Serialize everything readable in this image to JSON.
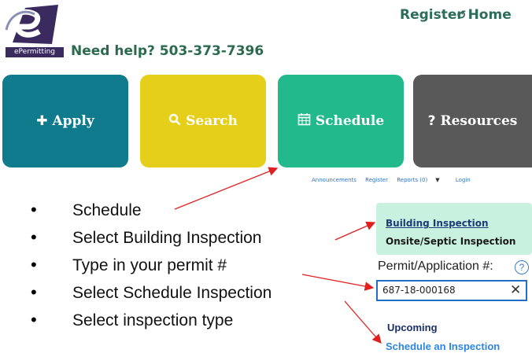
{
  "header": {
    "logo_tag": "ePermitting",
    "help_text": "Need help? 503-373-7396",
    "register_label": "Register",
    "home_label": "Home"
  },
  "tiles": [
    {
      "label": "Apply",
      "icon": "plus-icon"
    },
    {
      "label": "Search",
      "icon": "search-icon"
    },
    {
      "label": "Schedule",
      "icon": "calendar-icon"
    },
    {
      "label": "Resources",
      "icon": "question-icon"
    }
  ],
  "subnav": {
    "announcements": "Announcements",
    "register": "Register",
    "reports": "Reports (0)",
    "login": "Login"
  },
  "instructions": [
    "Schedule",
    "Select Building Inspection",
    "Type in your permit #",
    "Select Schedule Inspection",
    "Select inspection type"
  ],
  "inspection_panel": {
    "building": "Building Inspection",
    "onsite": "Onsite/Septic Inspection"
  },
  "permit_field": {
    "label": "Permit/Application #:",
    "value": "687-18-000168"
  },
  "actions": {
    "upcoming": "Upcoming",
    "schedule": "Schedule an Inspection"
  },
  "colors": {
    "apply": "#107b8c",
    "search": "#e6cf1a",
    "schedule": "#22b98c",
    "resources": "#595959",
    "arrow": "#e02020"
  }
}
